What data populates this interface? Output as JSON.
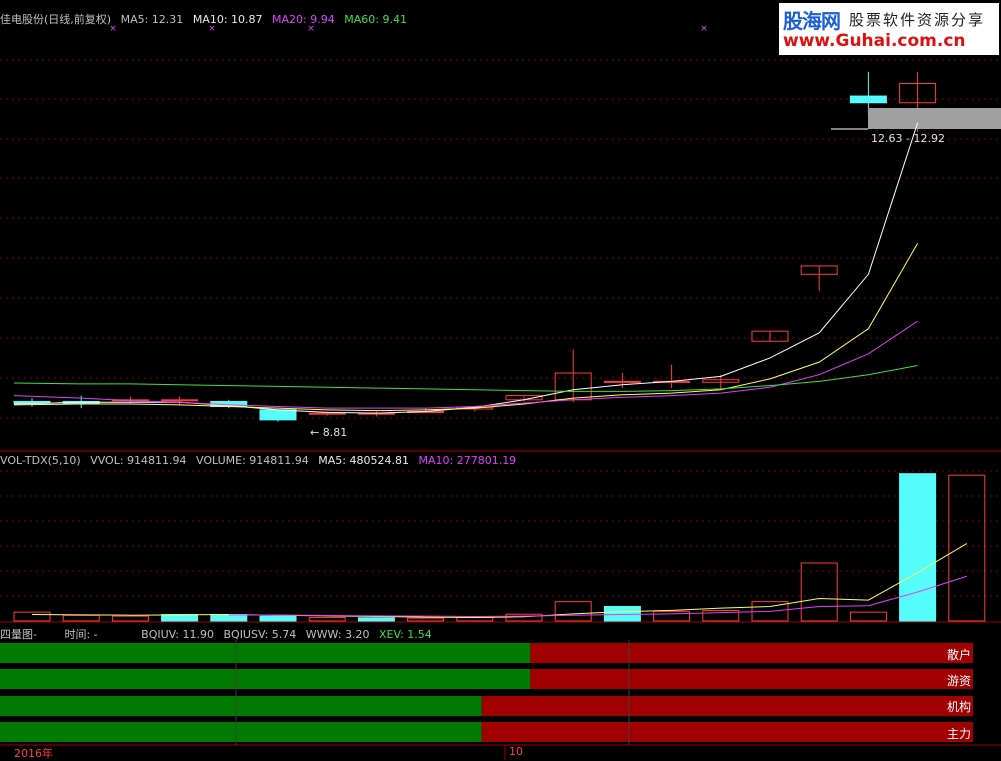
{
  "price_panel": {
    "title": "佳电股份(日线,前复权)",
    "ma5": "MA5: 12.31",
    "ma10": "MA10: 10.87",
    "ma20": "MA20: 9.94",
    "ma60": "MA60: 9.41",
    "low_marker": "← 8.81",
    "range_label": "12.63 - 12.92"
  },
  "volume_panel": {
    "title": "VOL-TDX(5,10)",
    "vvol": "VVOL: 914811.94",
    "volume": "VOLUME: 914811.94",
    "ma5": "MA5: 480524.81",
    "ma10": "MA10: 277801.19"
  },
  "flow_panel": {
    "title": "四量图-",
    "time": "时间: -",
    "bqiuv": "BQIUV: 11.90",
    "bqiusv": "BQIUSV: 5.74",
    "www": "WWW: 3.20",
    "xev": "XEV: 1.54",
    "rows": [
      {
        "label": "散户",
        "green_frac": 0.545
      },
      {
        "label": "游资",
        "green_frac": 0.545
      },
      {
        "label": "机构",
        "green_frac": 0.495
      },
      {
        "label": "主力",
        "green_frac": 0.495
      }
    ]
  },
  "axis": {
    "year_label": "2016年",
    "month_label": "10"
  },
  "watermark": {
    "brand": "股海网",
    "slogan": "股票软件资源分享",
    "url": "www.Guhai.com.cn"
  },
  "colors": {
    "up": "#ff3c3c",
    "down": "#54fcfc",
    "ma5": "#ffffff",
    "ma10": "#ffff5a",
    "ma20": "#e040fb",
    "ma60": "#40e040",
    "green_bar": "#007a00",
    "red_bar": "#a00000"
  },
  "chart_data": [
    {
      "type": "candlestick",
      "title": "佳电股份(日线,前复权)",
      "ylim": [
        8.4,
        13.3
      ],
      "candles": [
        {
          "o": 8.98,
          "h": 9.02,
          "l": 8.92,
          "c": 8.96
        },
        {
          "o": 8.98,
          "h": 9.05,
          "l": 8.9,
          "c": 8.95
        },
        {
          "o": 9.0,
          "h": 9.04,
          "l": 8.96,
          "c": 9.0
        },
        {
          "o": 8.99,
          "h": 9.04,
          "l": 8.93,
          "c": 9.0
        },
        {
          "o": 8.98,
          "h": 9.0,
          "l": 8.9,
          "c": 8.92
        },
        {
          "o": 8.88,
          "h": 8.88,
          "l": 8.74,
          "c": 8.76
        },
        {
          "o": 8.83,
          "h": 8.86,
          "l": 8.81,
          "c": 8.84
        },
        {
          "o": 8.83,
          "h": 8.86,
          "l": 8.8,
          "c": 8.84
        },
        {
          "o": 8.86,
          "h": 8.9,
          "l": 8.84,
          "c": 8.86
        },
        {
          "o": 8.89,
          "h": 8.93,
          "l": 8.86,
          "c": 8.91
        },
        {
          "o": 9.0,
          "h": 9.04,
          "l": 8.98,
          "c": 9.05
        },
        {
          "o": 9.0,
          "h": 9.6,
          "l": 8.97,
          "c": 9.32
        },
        {
          "o": 9.22,
          "h": 9.32,
          "l": 9.14,
          "c": 9.22
        },
        {
          "o": 9.22,
          "h": 9.42,
          "l": 9.14,
          "c": 9.22
        },
        {
          "o": 9.21,
          "h": 9.3,
          "l": 9.12,
          "c": 9.24
        },
        {
          "o": 9.7,
          "h": 9.82,
          "l": 9.7,
          "c": 9.82
        },
        {
          "o": 10.5,
          "h": 10.6,
          "l": 10.3,
          "c": 10.6
        },
        {
          "o": 12.63,
          "h": 12.92,
          "l": 12.4,
          "c": 12.55
        },
        {
          "o": 12.55,
          "h": 12.92,
          "l": 12.2,
          "c": 12.78
        }
      ],
      "ma": {
        "MA5": [
          8.95,
          8.97,
          8.97,
          8.97,
          8.93,
          8.88,
          8.85,
          8.84,
          8.86,
          8.91,
          9.0,
          9.12,
          9.18,
          9.22,
          9.28,
          9.5,
          9.8,
          10.5,
          12.31
        ],
        "MA10": [
          8.94,
          8.95,
          8.95,
          8.94,
          8.92,
          8.9,
          8.88,
          8.87,
          8.88,
          8.9,
          8.95,
          9.02,
          9.06,
          9.08,
          9.12,
          9.25,
          9.45,
          9.85,
          10.87
        ],
        "MA20": [
          9.05,
          9.02,
          8.99,
          8.97,
          8.94,
          8.92,
          8.9,
          8.9,
          8.9,
          8.92,
          8.96,
          9.0,
          9.03,
          9.05,
          9.08,
          9.15,
          9.3,
          9.55,
          9.94
        ],
        "MA60": [
          9.2,
          9.19,
          9.19,
          9.18,
          9.17,
          9.16,
          9.15,
          9.14,
          9.13,
          9.12,
          9.11,
          9.1,
          9.1,
          9.11,
          9.13,
          9.17,
          9.22,
          9.3,
          9.41
        ]
      }
    },
    {
      "type": "bar",
      "title": "VOL-TDX(5,10)",
      "ylim": [
        0,
        950000
      ],
      "volumes": [
        55000,
        35000,
        30000,
        40000,
        40000,
        30000,
        22000,
        20000,
        18000,
        22000,
        42000,
        120000,
        90000,
        60000,
        65000,
        120000,
        360000,
        55000,
        914811.94,
        905000
      ],
      "down_flags": [
        false,
        false,
        false,
        true,
        true,
        true,
        false,
        true,
        false,
        false,
        false,
        false,
        true,
        false,
        false,
        false,
        false,
        false,
        true,
        false
      ],
      "ma5": [
        40000,
        38000,
        36000,
        38000,
        40000,
        36000,
        32000,
        28000,
        24000,
        22000,
        26000,
        44000,
        58000,
        66000,
        80000,
        90000,
        140000,
        130000,
        300000,
        480524.81
      ],
      "ma10": [
        null,
        null,
        null,
        null,
        38000,
        37000,
        34000,
        32000,
        30000,
        28000,
        30000,
        36000,
        40000,
        44000,
        52000,
        60000,
        90000,
        95000,
        180000,
        277801.19
      ]
    }
  ]
}
